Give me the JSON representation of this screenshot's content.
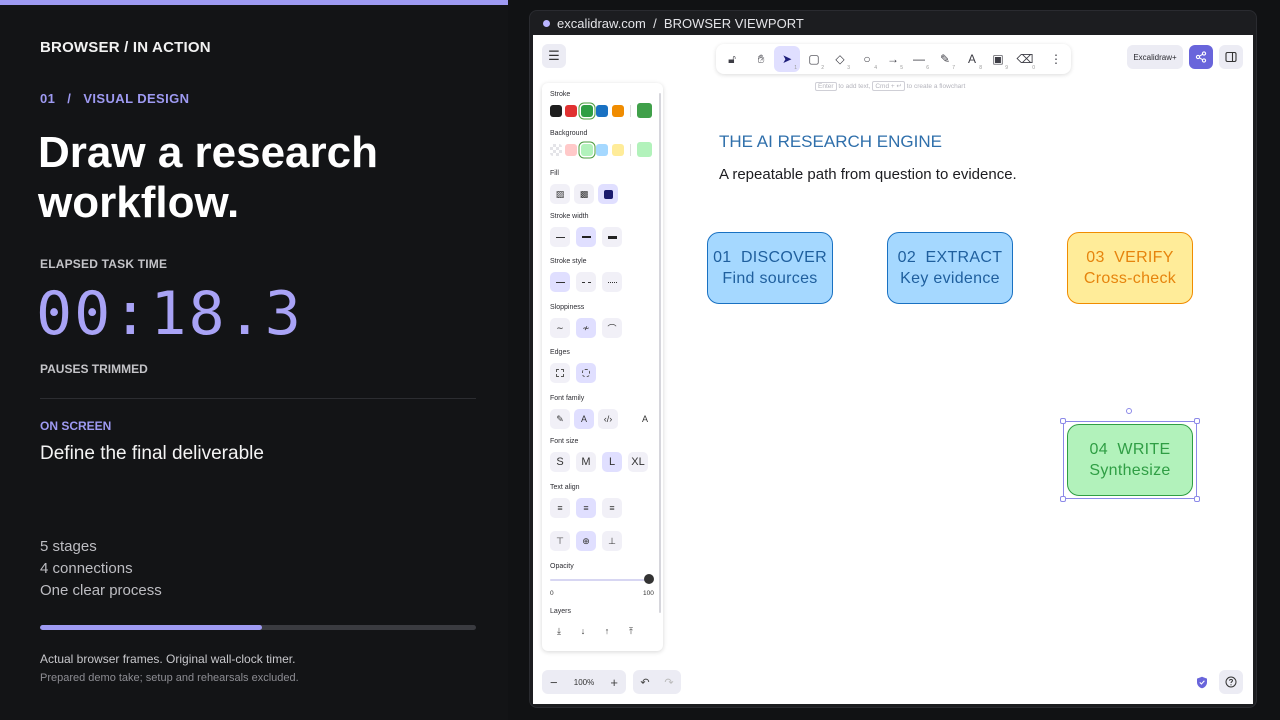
{
  "left": {
    "section_label": "BROWSER / IN ACTION",
    "breadcrumb": "01   /   VISUAL DESIGN",
    "headline": "Draw a research workflow.",
    "timer_label": "ELAPSED TASK TIME",
    "timer": "00:18.3",
    "timer_note": "PAUSES TRIMMED",
    "onscreen_label": "ON SCREEN",
    "onscreen_value": "Define the final deliverable",
    "stats": [
      "5 stages",
      "4 connections",
      "One clear process"
    ],
    "progress": 0.51,
    "footnote_primary": "Actual browser frames. Original wall-clock timer.",
    "footnote_secondary": "Prepared demo take; setup and rehearsals excluded.",
    "colors": {
      "accent": "#9e9af2",
      "timer": "#a9a3f6",
      "background": "#131416"
    }
  },
  "browser": {
    "url": "excalidraw.com  /  BROWSER VIEWPORT"
  },
  "excalidraw": {
    "toolbar": [
      {
        "icon": "lock-icon",
        "sub": ""
      },
      {
        "icon": "hand-icon",
        "sub": ""
      },
      {
        "icon": "selection-icon",
        "sub": "1",
        "active": true
      },
      {
        "icon": "rectangle-icon",
        "sub": "2"
      },
      {
        "icon": "diamond-icon",
        "sub": "3"
      },
      {
        "icon": "ellipse-icon",
        "sub": "4"
      },
      {
        "icon": "arrow-icon",
        "sub": "5"
      },
      {
        "icon": "line-icon",
        "sub": "6"
      },
      {
        "icon": "pencil-icon",
        "sub": "7"
      },
      {
        "icon": "text-icon",
        "sub": "8"
      },
      {
        "icon": "image-icon",
        "sub": "9"
      },
      {
        "icon": "eraser-icon",
        "sub": "0"
      },
      {
        "icon": "more-icon",
        "sub": ""
      }
    ],
    "hint": {
      "key1": "Enter",
      "text1": "to add text,",
      "key2": "Cmd + ↵",
      "text2": "to create a flowchart"
    },
    "library_button": "Excalidraw+",
    "properties": {
      "stroke_label": "Stroke",
      "stroke_colors": [
        "#1e1e1e",
        "#e03131",
        "#2f9e44",
        "#1971c2",
        "#f08c00"
      ],
      "stroke_current": "#40a04a",
      "background_label": "Background",
      "background_colors": [
        "transparent",
        "#ffc9c9",
        "#b2f2bb",
        "#a5d8ff",
        "#ffec99"
      ],
      "background_current": "#b2f2bb",
      "fill_label": "Fill",
      "stroke_width_label": "Stroke width",
      "stroke_style_label": "Stroke style",
      "sloppiness_label": "Sloppiness",
      "edges_label": "Edges",
      "font_family_label": "Font family",
      "font_size_label": "Font size",
      "font_sizes": [
        "S",
        "M",
        "L",
        "XL"
      ],
      "text_align_label": "Text align",
      "opacity_label": "Opacity",
      "opacity_min": "0",
      "opacity_max": "100",
      "opacity_value": 100,
      "layers_label": "Layers"
    },
    "canvas": {
      "title": "THE AI RESEARCH ENGINE",
      "subtitle": "A repeatable path from question to evidence.",
      "stages": [
        {
          "number": "01  DISCOVER",
          "label": "Find sources",
          "fill": "#a5d8ff",
          "stroke": "#1971c2",
          "text": "#1f5f9e"
        },
        {
          "number": "02  EXTRACT",
          "label": "Key evidence",
          "fill": "#a5d8ff",
          "stroke": "#1971c2",
          "text": "#1f5f9e"
        },
        {
          "number": "03  VERIFY",
          "label": "Cross-check",
          "fill": "#ffec99",
          "stroke": "#f08c00",
          "text": "#e6840d"
        },
        {
          "number": "04  WRITE",
          "label": "Synthesize",
          "fill": "#b2f2bb",
          "stroke": "#2f9e44",
          "text": "#2f9e44"
        }
      ]
    },
    "zoom": "100%"
  }
}
